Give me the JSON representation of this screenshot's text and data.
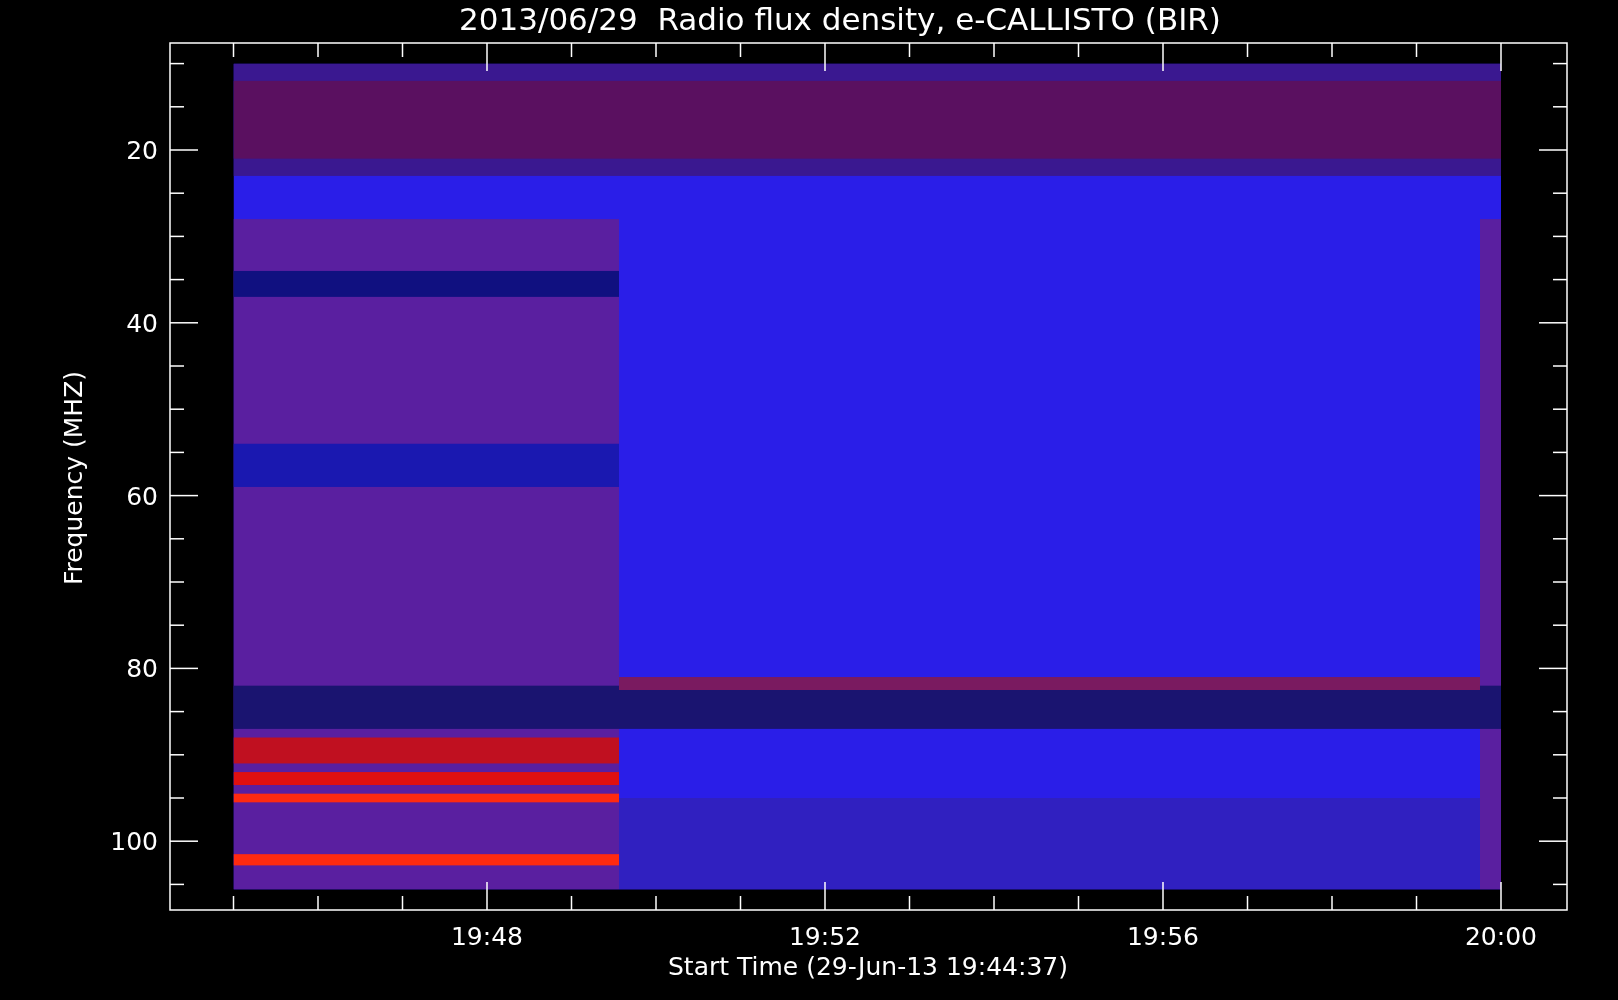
{
  "title": "2013/06/29  Radio flux density, e-CALLISTO (BIR)",
  "y_axis": {
    "label": "Frequency (MHZ)",
    "ticks": [
      "20",
      "40",
      "60",
      "80",
      "100"
    ]
  },
  "x_axis": {
    "label": "Start Time (29-Jun-13 19:44:37)",
    "ticks": [
      "19:48",
      "19:52",
      "19:56",
      "20:00"
    ]
  }
}
